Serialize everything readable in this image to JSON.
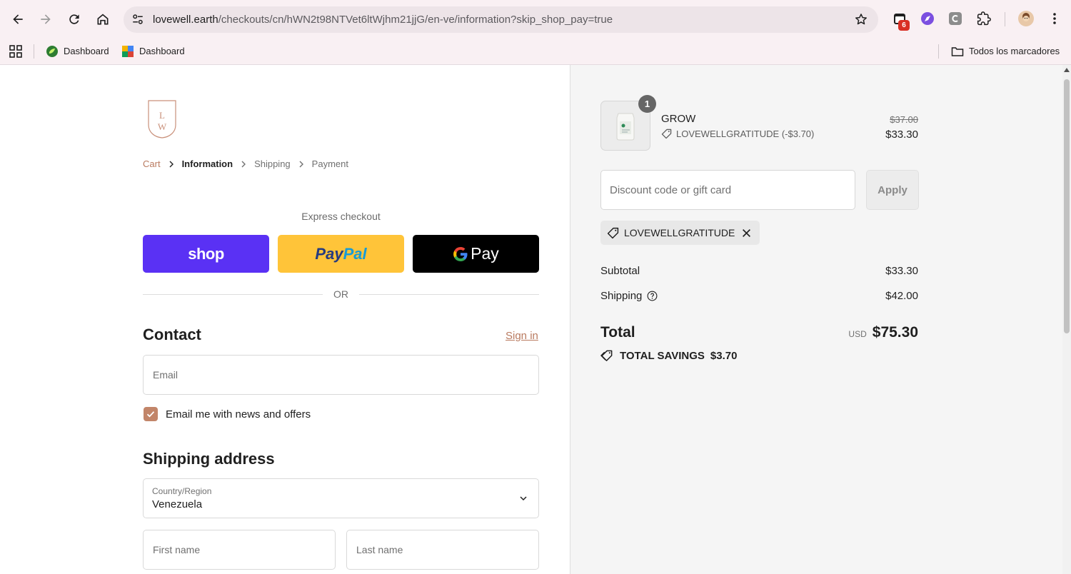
{
  "browser": {
    "url_host": "lovewell.earth",
    "url_path": "/checkouts/cn/hWN2t98NTVet6ltWjhm21jjG/en-ve/information?skip_shop_pay=true",
    "notification_count": "6",
    "bookmarks": [
      {
        "label": "Dashboard"
      },
      {
        "label": "Dashboard"
      }
    ],
    "all_bookmarks_label": "Todos los marcadores"
  },
  "checkout": {
    "breadcrumb": {
      "cart": "Cart",
      "information": "Information",
      "shipping": "Shipping",
      "payment": "Payment"
    },
    "express_title": "Express checkout",
    "express": {
      "shop": "shop",
      "paypal_a": "Pay",
      "paypal_b": "Pal",
      "gpay": "Pay"
    },
    "or_text": "OR",
    "contact": {
      "heading": "Contact",
      "sign_in": "Sign in",
      "email_placeholder": "Email",
      "news_label": "Email me with news and offers",
      "news_checked": true
    },
    "shipping_address": {
      "heading": "Shipping address",
      "country_label": "Country/Region",
      "country_value": "Venezuela",
      "first_name_placeholder": "First name",
      "last_name_placeholder": "Last name"
    }
  },
  "summary": {
    "product": {
      "name": "GROW",
      "quantity": "1",
      "discount_label": "LOVEWELLGRATITUDE (-$3.70)",
      "original_price": "$37.00",
      "price": "$33.30"
    },
    "discount_placeholder": "Discount code or gift card",
    "apply_label": "Apply",
    "applied_code": "LOVEWELLGRATITUDE",
    "subtotal_label": "Subtotal",
    "subtotal_value": "$33.30",
    "shipping_label": "Shipping",
    "shipping_value": "$42.00",
    "total_label": "Total",
    "currency": "USD",
    "total_value": "$75.30",
    "savings_label": "TOTAL SAVINGS",
    "savings_value": "$3.70"
  },
  "colors": {
    "accent": "#b97a5f",
    "shop_pay": "#5a31f4",
    "paypal": "#ffc439",
    "checkbox": "#c28569"
  }
}
